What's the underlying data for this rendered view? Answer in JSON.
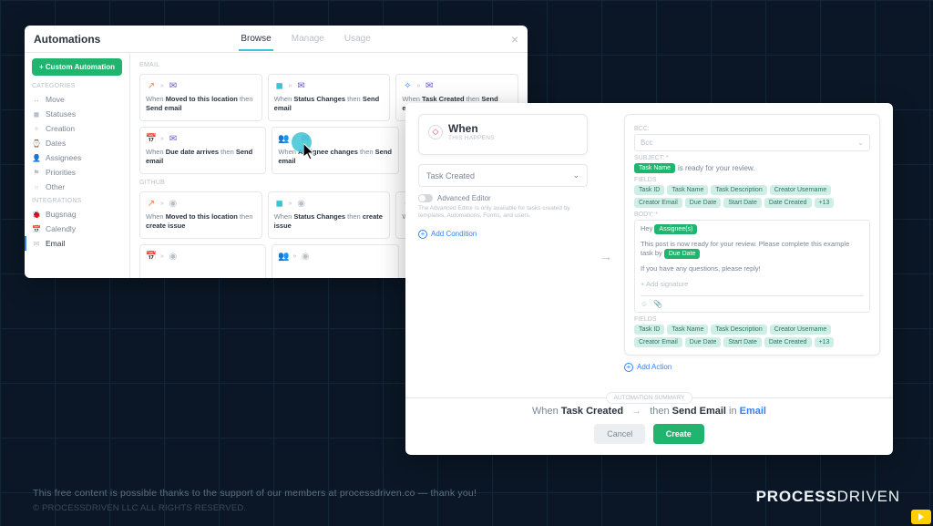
{
  "automations": {
    "title": "Automations",
    "tabs": [
      "Browse",
      "Manage",
      "Usage"
    ],
    "active_tab": "Browse",
    "custom_btn": "+  Custom Automation",
    "side": {
      "categories_label": "CATEGORIES",
      "categories": [
        {
          "icon": "↔",
          "label": "Move"
        },
        {
          "icon": "◼",
          "label": "Statuses"
        },
        {
          "icon": "✧",
          "label": "Creation"
        },
        {
          "icon": "⌚",
          "label": "Dates"
        },
        {
          "icon": "👤",
          "label": "Assignees"
        },
        {
          "icon": "⚑",
          "label": "Priorities"
        },
        {
          "icon": "○",
          "label": "Other"
        }
      ],
      "integrations_label": "INTEGRATIONS",
      "integrations": [
        {
          "icon": "🐞",
          "label": "Bugsnag"
        },
        {
          "icon": "📅",
          "label": "Calendly"
        },
        {
          "icon": "✉",
          "label": "Email",
          "active": true
        }
      ]
    },
    "sections": {
      "email_label": "EMAIL",
      "email_cards": [
        {
          "i1": "↗",
          "c1": "orange",
          "i2": "✉",
          "c2": "purple",
          "t": "When <b>Moved to this location</b> then <b>Send email</b>"
        },
        {
          "i1": "◼",
          "c1": "teal",
          "i2": "✉",
          "c2": "purple",
          "t": "When <b>Status Changes</b> then <b>Send email</b>"
        },
        {
          "i1": "✧",
          "c1": "blue",
          "i2": "✉",
          "c2": "purple",
          "t": "When <b>Task Created</b> then <b>Send email</b>"
        },
        {
          "i1": "📅",
          "c1": "orange",
          "i2": "✉",
          "c2": "purple",
          "t": "When <b>Due date arrives</b> then <b>Send email</b>"
        },
        {
          "i1": "👥",
          "c1": "blue",
          "i2": "✉",
          "c2": "purple",
          "t": "When <b>Assignee changes</b> then <b>Send email</b>"
        }
      ],
      "github_label": "GITHUB",
      "github_cards": [
        {
          "i1": "↗",
          "c1": "orange",
          "i2": "◉",
          "c2": "",
          "t": "When <b>Moved to this location</b> then <b>create issue</b>"
        },
        {
          "i1": "◼",
          "c1": "teal",
          "i2": "◉",
          "c2": "",
          "t": "When <b>Status Changes</b> then <b>create issue</b>"
        },
        {
          "i1": "✧",
          "c1": "blue",
          "i2": "◉",
          "c2": "",
          "t": "Wh"
        }
      ],
      "github_cards2": [
        {
          "i1": "📅",
          "c1": "orange",
          "i2": "◉",
          "c2": ""
        },
        {
          "i1": "👥",
          "c1": "blue",
          "i2": "◉",
          "c2": ""
        }
      ]
    }
  },
  "builder": {
    "when": {
      "title": "When",
      "subtitle": "THIS HAPPENS",
      "trigger": "Task Created",
      "advanced": "Advanced Editor",
      "advanced_note": "The Advanced Editor is only available for tasks created by templates, Automations, Forms, and users.",
      "add_condition": "Add Condition"
    },
    "action": {
      "bcc_label": "BCC:",
      "bcc_placeholder": "Bcc",
      "subject_label": "SUBJECT: *",
      "subject_pill": "Task Name",
      "subject_suffix": "is ready for your review.",
      "fields_label": "FIELDS",
      "fields": [
        "Task ID",
        "Task Name",
        "Task Description",
        "Creator Username",
        "Creator Email",
        "Due Date",
        "Start Date",
        "Date Created",
        "+13"
      ],
      "body_label": "BODY: *",
      "body": {
        "line1_pre": "Hey ",
        "line1_pill": "Assignee(s)",
        "line2": "This post is now ready for your review. Please complete this example task by ",
        "line2_pill": "Due Date",
        "line3": "If you have any questions, please reply!",
        "signature": "+ Add signature"
      },
      "fields2": [
        "Task ID",
        "Task Name",
        "Task Description",
        "Creator Username",
        "Creator Email",
        "Due Date",
        "Start Date",
        "Date Created",
        "+13"
      ],
      "add_action": "Add Action"
    },
    "summary_label": "AUTOMATION SUMMARY",
    "summary": {
      "when_pre": "When ",
      "when": "Task Created",
      "then_pre": "then ",
      "then": "Send Email",
      "in_pre": " in ",
      "in": "Email"
    },
    "cancel": "Cancel",
    "create": "Create"
  },
  "overlay": {
    "credit": "This free content is possible thanks to the support of our members at processdriven.co — thank you!",
    "copyright": "© PROCESSDRIVEN LLC ALL RIGHTS RESERVED.",
    "brand_a": "PROCESS",
    "brand_b": "DRIVEN"
  }
}
